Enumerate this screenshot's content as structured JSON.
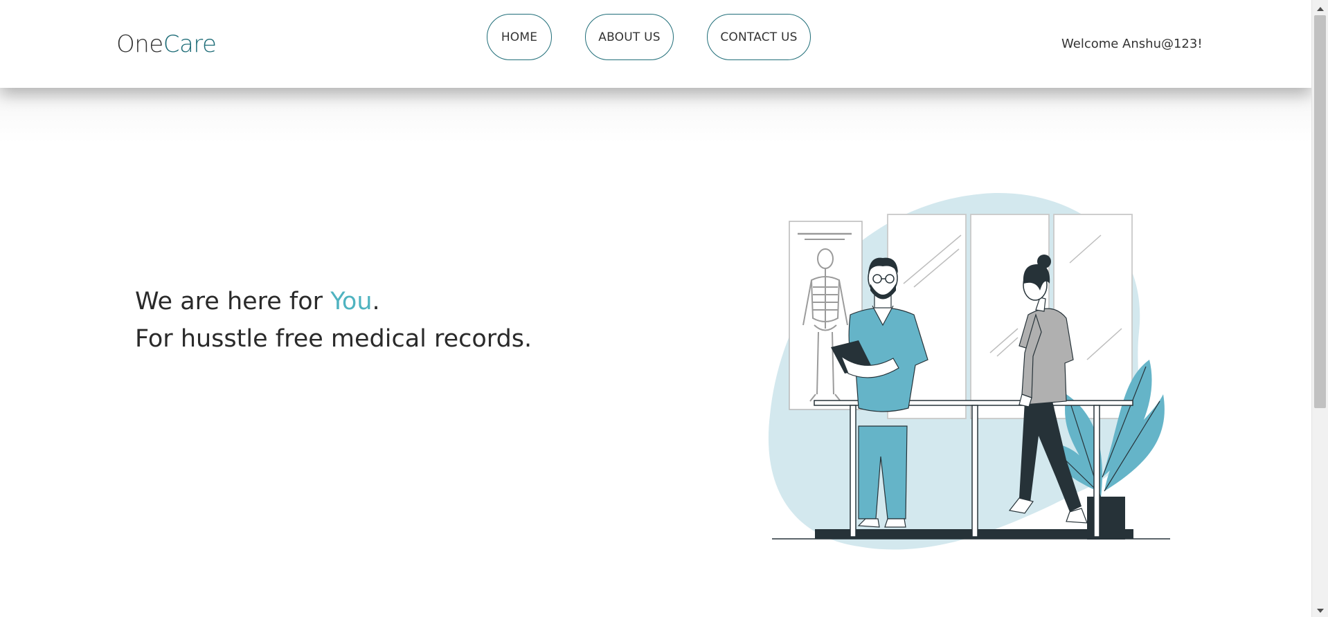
{
  "brand": {
    "part1": "One",
    "part2": "Care"
  },
  "nav": {
    "home": "HOME",
    "about": "ABOUT US",
    "contact": "CONTACT US"
  },
  "user": {
    "welcome": "Welcome Anshu@123!"
  },
  "hero": {
    "line1_prefix": "We are here for ",
    "line1_highlight": "You",
    "line1_suffix": ".",
    "line2": "For husstle free medical records."
  },
  "colors": {
    "brand_accent": "#1f6d78",
    "highlight": "#4fb3c0",
    "illustration_blob": "#d3e8ee",
    "illustration_teal": "#65b4c8",
    "illustration_dark": "#263238"
  },
  "illustration": {
    "icon": "doctor-patient-rehab-illustration"
  }
}
